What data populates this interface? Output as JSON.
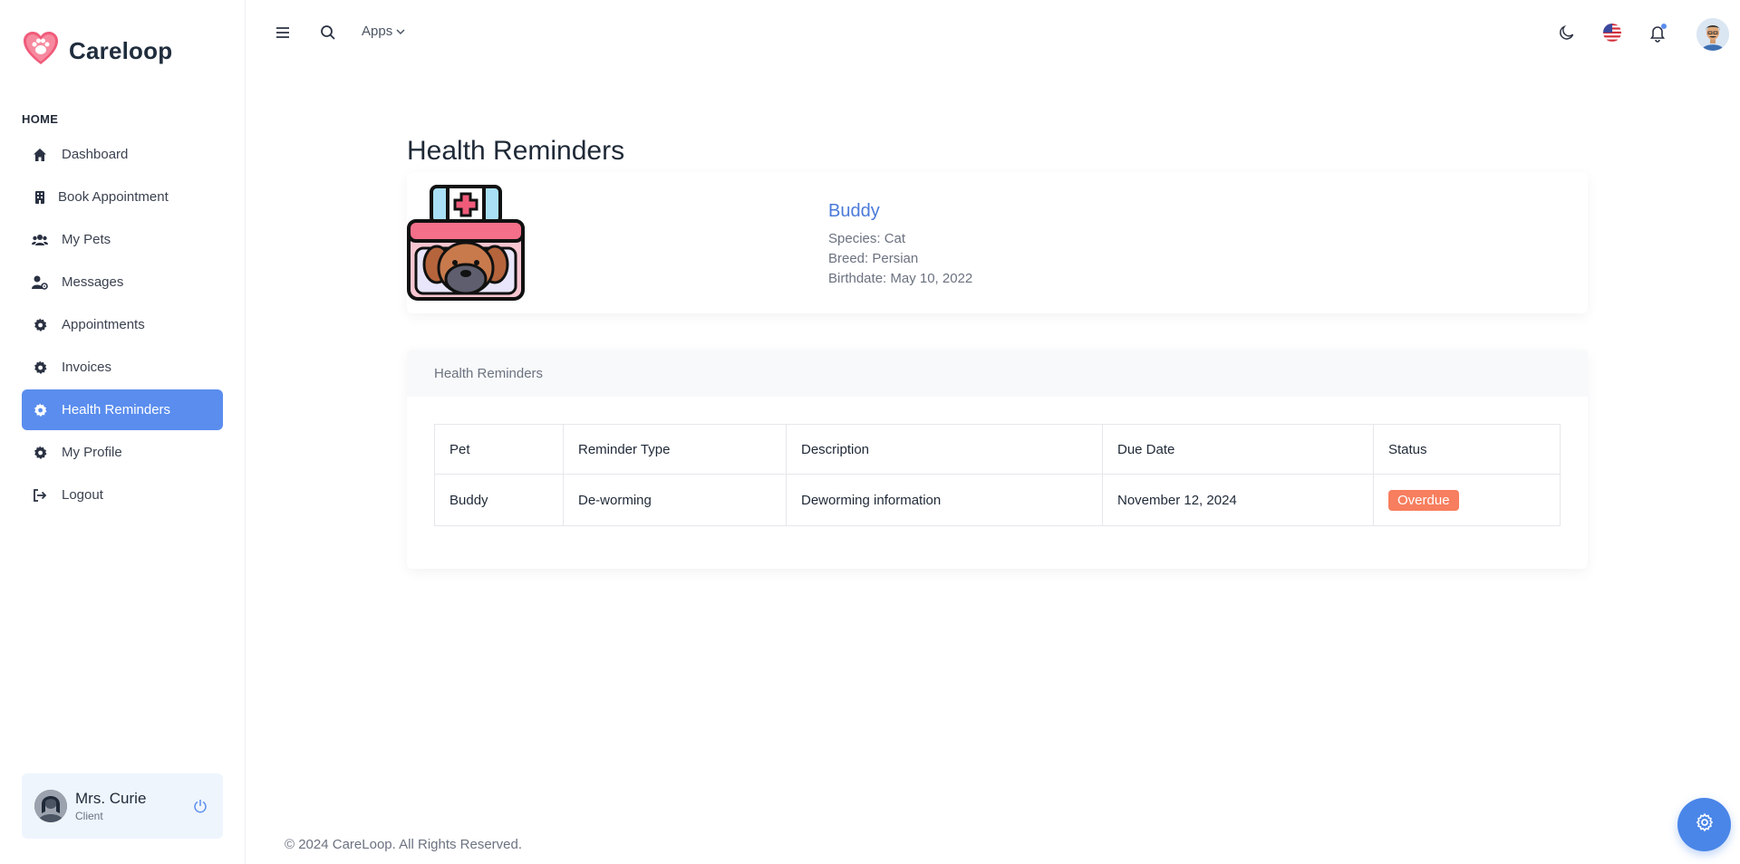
{
  "brand": {
    "name": "Careloop",
    "logo_icon": "heart-paw-icon",
    "accent": "#f05b7a"
  },
  "sidebar": {
    "section_label": "HOME",
    "items": [
      {
        "label": "Dashboard",
        "icon": "home-icon",
        "active": false
      },
      {
        "label": "Book Appointment",
        "icon": "building-icon",
        "active": false
      },
      {
        "label": "My Pets",
        "icon": "users-icon",
        "active": false
      },
      {
        "label": "Messages",
        "icon": "user-gear-icon",
        "active": false
      },
      {
        "label": "Appointments",
        "icon": "gear-icon",
        "active": false
      },
      {
        "label": "Invoices",
        "icon": "gear-icon",
        "active": false
      },
      {
        "label": "Health Reminders",
        "icon": "gear-icon",
        "active": true
      },
      {
        "label": "My Profile",
        "icon": "gear-icon",
        "active": false
      },
      {
        "label": "Logout",
        "icon": "logout-icon",
        "active": false
      }
    ],
    "active_color": "#5a8dee"
  },
  "user": {
    "name": "Mrs. Curie",
    "role": "Client"
  },
  "topbar": {
    "apps_label": "Apps"
  },
  "page": {
    "title": "Health Reminders"
  },
  "pet": {
    "name": "Buddy",
    "species": "Species: Cat",
    "breed": "Breed: Persian",
    "birthdate": "Birthdate: May 10, 2022"
  },
  "reminders": {
    "card_title": "Health Reminders",
    "columns": [
      "Pet",
      "Reminder Type",
      "Description",
      "Due Date",
      "Status"
    ],
    "rows": [
      {
        "pet": "Buddy",
        "type": "De-worming",
        "description": "Deworming information",
        "due": "November 12, 2024",
        "status": "Overdue"
      }
    ],
    "status_color": "#f77e5e"
  },
  "footer": {
    "text": "© 2024 CareLoop. All Rights Reserved."
  }
}
